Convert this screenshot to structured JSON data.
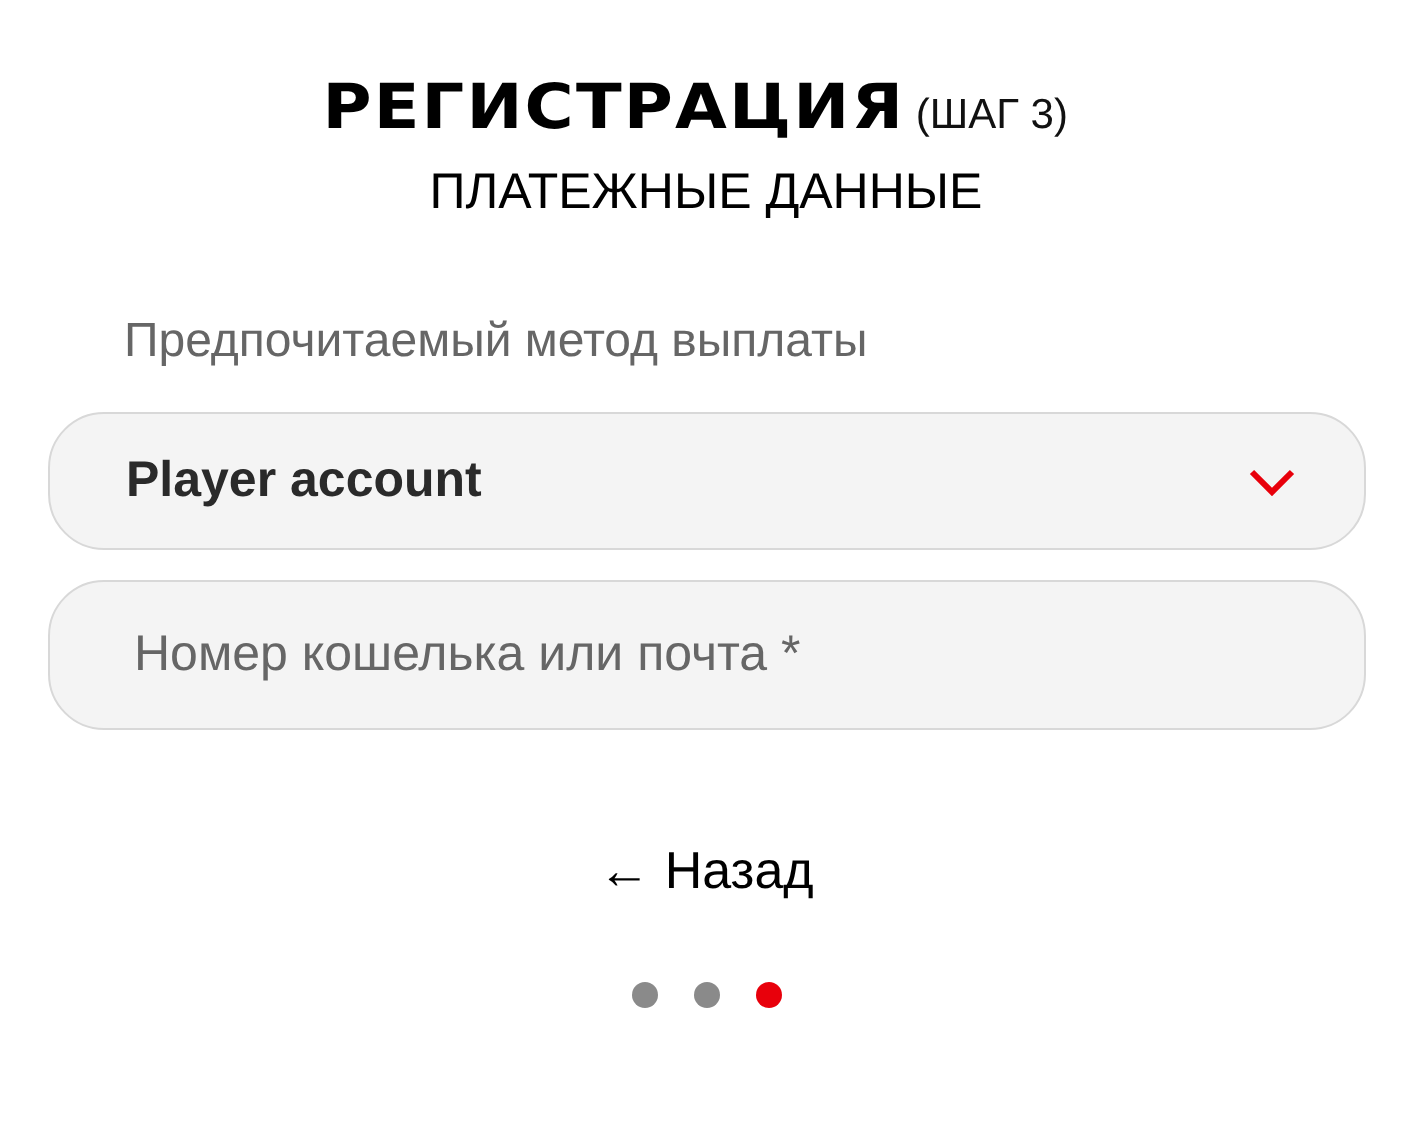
{
  "header": {
    "title": "РЕГИСТРАЦИЯ",
    "step": "(ШАГ 3)",
    "subtitle": "ПЛАТЕЖНЫЕ ДАННЫЕ"
  },
  "payout": {
    "label": "Предпочитаемый метод выплаты",
    "value": "Player account"
  },
  "wallet": {
    "placeholder": "Номер кошелька или почта *"
  },
  "back_link": "← Назад",
  "steps": [
    {
      "selected": false
    },
    {
      "selected": false
    },
    {
      "selected": true
    }
  ]
}
